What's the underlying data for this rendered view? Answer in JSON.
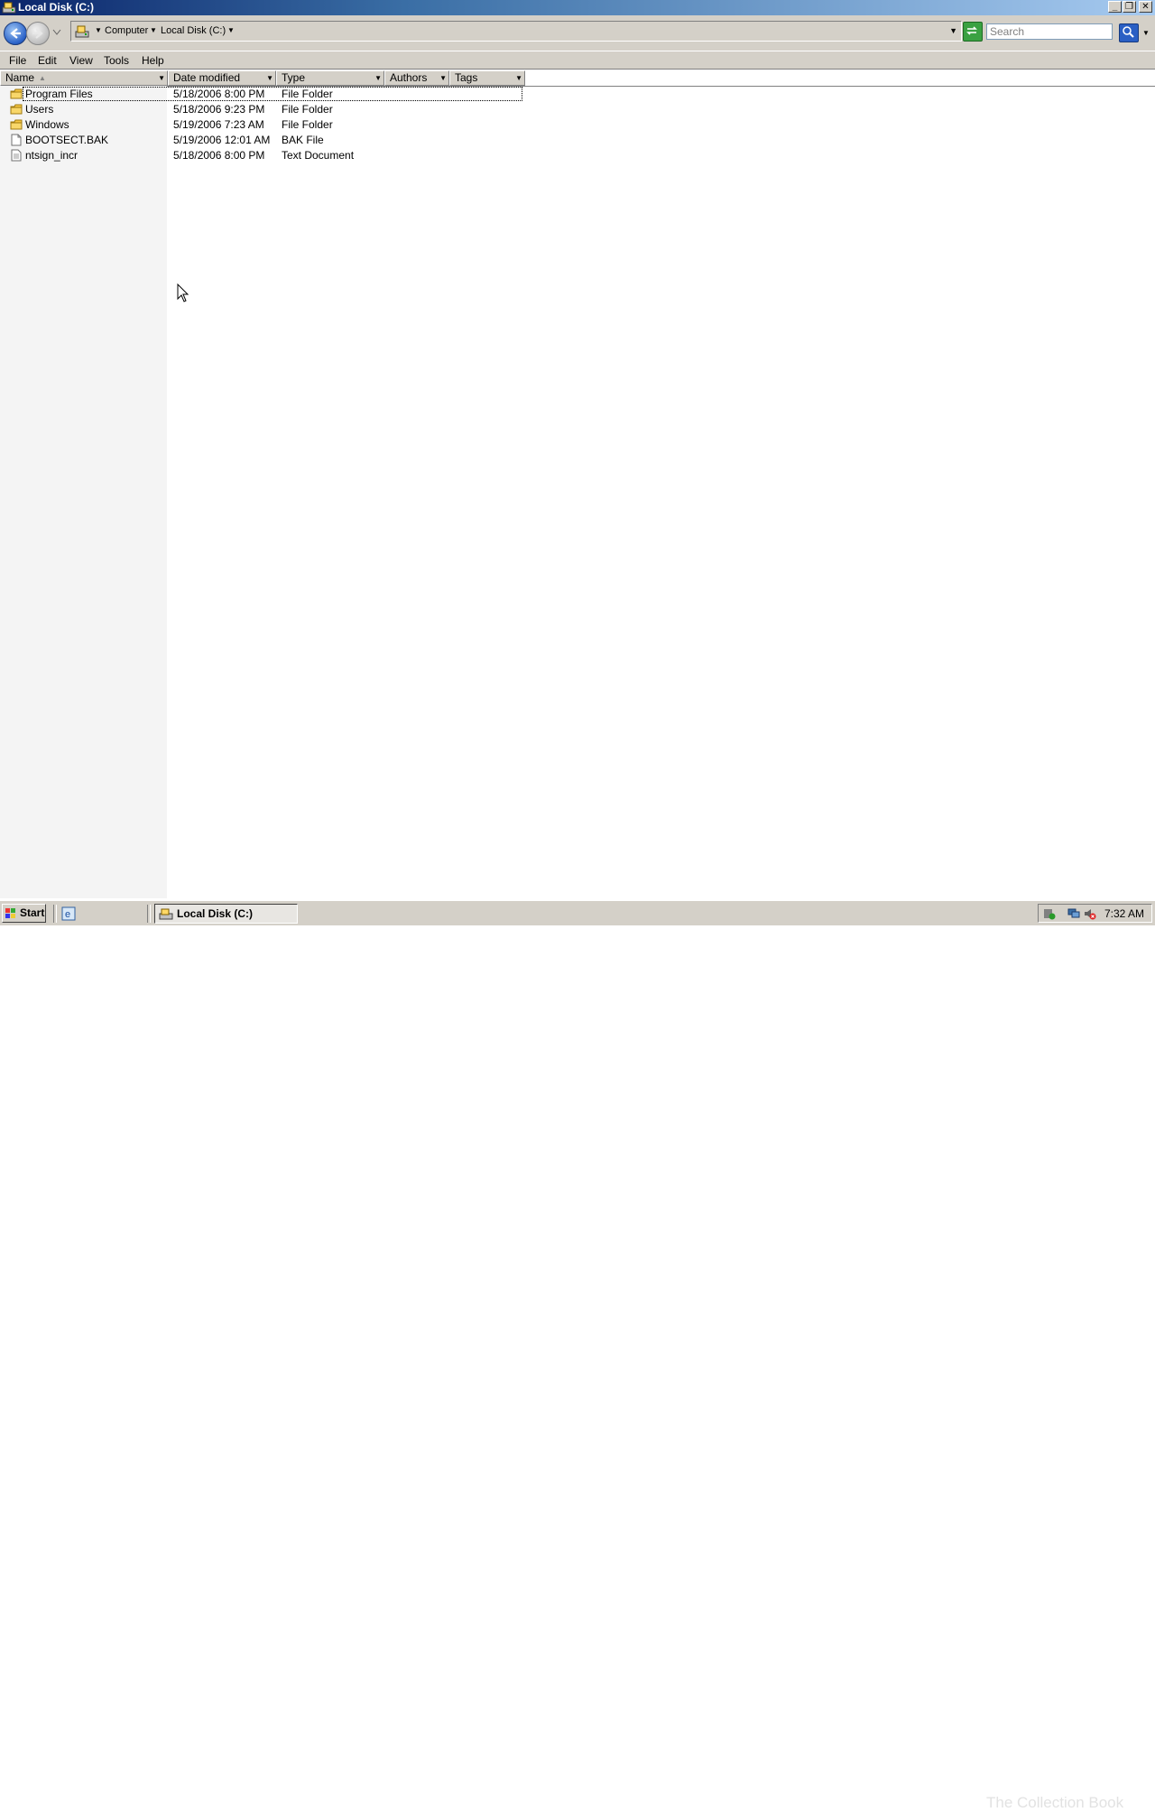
{
  "window": {
    "title": "Local Disk (C:)"
  },
  "address": {
    "crumbs": [
      "Computer",
      "Local Disk (C:)"
    ],
    "search_placeholder": "Search"
  },
  "menu": [
    "File",
    "Edit",
    "View",
    "Tools",
    "Help"
  ],
  "columns": {
    "name": "Name",
    "date": "Date modified",
    "type": "Type",
    "authors": "Authors",
    "tags": "Tags"
  },
  "files": [
    {
      "name": "Program Files",
      "date": "5/18/2006 8:00 PM",
      "type": "File Folder",
      "icon": "folder-icon"
    },
    {
      "name": "Users",
      "date": "5/18/2006 9:23 PM",
      "type": "File Folder",
      "icon": "folder-icon"
    },
    {
      "name": "Windows",
      "date": "5/19/2006 7:23 AM",
      "type": "File Folder",
      "icon": "folder-icon"
    },
    {
      "name": "BOOTSECT.BAK",
      "date": "5/19/2006 12:01 AM",
      "type": "BAK File",
      "icon": "file-icon"
    },
    {
      "name": "ntsign_incr",
      "date": "5/18/2006 8:00 PM",
      "type": "Text Document",
      "icon": "text-file-icon"
    }
  ],
  "taskbar": {
    "start_label": "Start",
    "task_label": "Local Disk (C:)",
    "clock": "7:32 AM",
    "watermark": "The Collection Book"
  }
}
